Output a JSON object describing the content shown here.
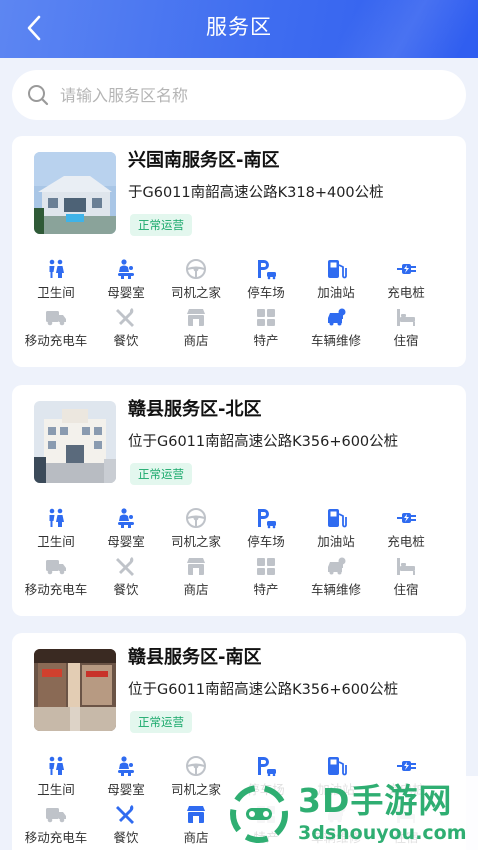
{
  "header": {
    "title": "服务区",
    "back_icon": "back-arrow-icon"
  },
  "search": {
    "placeholder": "请输入服务区名称",
    "value": ""
  },
  "colors": {
    "header_blue": "#3f6df0",
    "accent_blue": "#2f6bf0",
    "status_green": "#17a86a",
    "status_bg": "#e3f7ee",
    "inactive_gray": "#bfc3c9"
  },
  "service_areas": [
    {
      "name": "兴国南服务区-南区",
      "location": "于G6011南韶高速公路K318+400公桩",
      "status": "正常运营",
      "facilities": [
        {
          "label": "卫生间",
          "icon": "restroom-icon",
          "available": true
        },
        {
          "label": "母婴室",
          "icon": "mother-baby-icon",
          "available": true
        },
        {
          "label": "司机之家",
          "icon": "steering-wheel-icon",
          "available": false
        },
        {
          "label": "停车场",
          "icon": "parking-icon",
          "available": true
        },
        {
          "label": "加油站",
          "icon": "fuel-pump-icon",
          "available": true
        },
        {
          "label": "充电桩",
          "icon": "charging-plug-icon",
          "available": true
        },
        {
          "label": "移动充电车",
          "icon": "charging-truck-icon",
          "available": false
        },
        {
          "label": "餐饮",
          "icon": "utensils-icon",
          "available": false
        },
        {
          "label": "商店",
          "icon": "store-icon",
          "available": false
        },
        {
          "label": "特产",
          "icon": "specialty-icon",
          "available": false
        },
        {
          "label": "车辆维修",
          "icon": "car-repair-icon",
          "available": true
        },
        {
          "label": "住宿",
          "icon": "bed-icon",
          "available": false
        }
      ]
    },
    {
      "name": "赣县服务区-北区",
      "location": "位于G6011南韶高速公路K356+600公桩",
      "status": "正常运营",
      "facilities": [
        {
          "label": "卫生间",
          "icon": "restroom-icon",
          "available": true
        },
        {
          "label": "母婴室",
          "icon": "mother-baby-icon",
          "available": true
        },
        {
          "label": "司机之家",
          "icon": "steering-wheel-icon",
          "available": false
        },
        {
          "label": "停车场",
          "icon": "parking-icon",
          "available": true
        },
        {
          "label": "加油站",
          "icon": "fuel-pump-icon",
          "available": true
        },
        {
          "label": "充电桩",
          "icon": "charging-plug-icon",
          "available": true
        },
        {
          "label": "移动充电车",
          "icon": "charging-truck-icon",
          "available": false
        },
        {
          "label": "餐饮",
          "icon": "utensils-icon",
          "available": false
        },
        {
          "label": "商店",
          "icon": "store-icon",
          "available": false
        },
        {
          "label": "特产",
          "icon": "specialty-icon",
          "available": false
        },
        {
          "label": "车辆维修",
          "icon": "car-repair-icon",
          "available": false
        },
        {
          "label": "住宿",
          "icon": "bed-icon",
          "available": false
        }
      ]
    },
    {
      "name": "赣县服务区-南区",
      "location": "位于G6011南韶高速公路K356+600公桩",
      "status": "正常运营",
      "facilities": [
        {
          "label": "卫生间",
          "icon": "restroom-icon",
          "available": true
        },
        {
          "label": "母婴室",
          "icon": "mother-baby-icon",
          "available": true
        },
        {
          "label": "司机之家",
          "icon": "steering-wheel-icon",
          "available": false
        },
        {
          "label": "停车场",
          "icon": "parking-icon",
          "available": true
        },
        {
          "label": "加油站",
          "icon": "fuel-pump-icon",
          "available": true
        },
        {
          "label": "充电桩",
          "icon": "charging-plug-icon",
          "available": true
        },
        {
          "label": "移动充电车",
          "icon": "charging-truck-icon",
          "available": false
        },
        {
          "label": "餐饮",
          "icon": "utensils-icon",
          "available": true
        },
        {
          "label": "商店",
          "icon": "store-icon",
          "available": true
        },
        {
          "label": "特产",
          "icon": "specialty-icon",
          "available": false
        },
        {
          "label": "车辆维修",
          "icon": "car-repair-icon",
          "available": false
        },
        {
          "label": "住宿",
          "icon": "bed-icon",
          "available": false
        }
      ]
    }
  ],
  "watermark": {
    "name": "3D手游网",
    "url": "3dshouyou.com"
  }
}
